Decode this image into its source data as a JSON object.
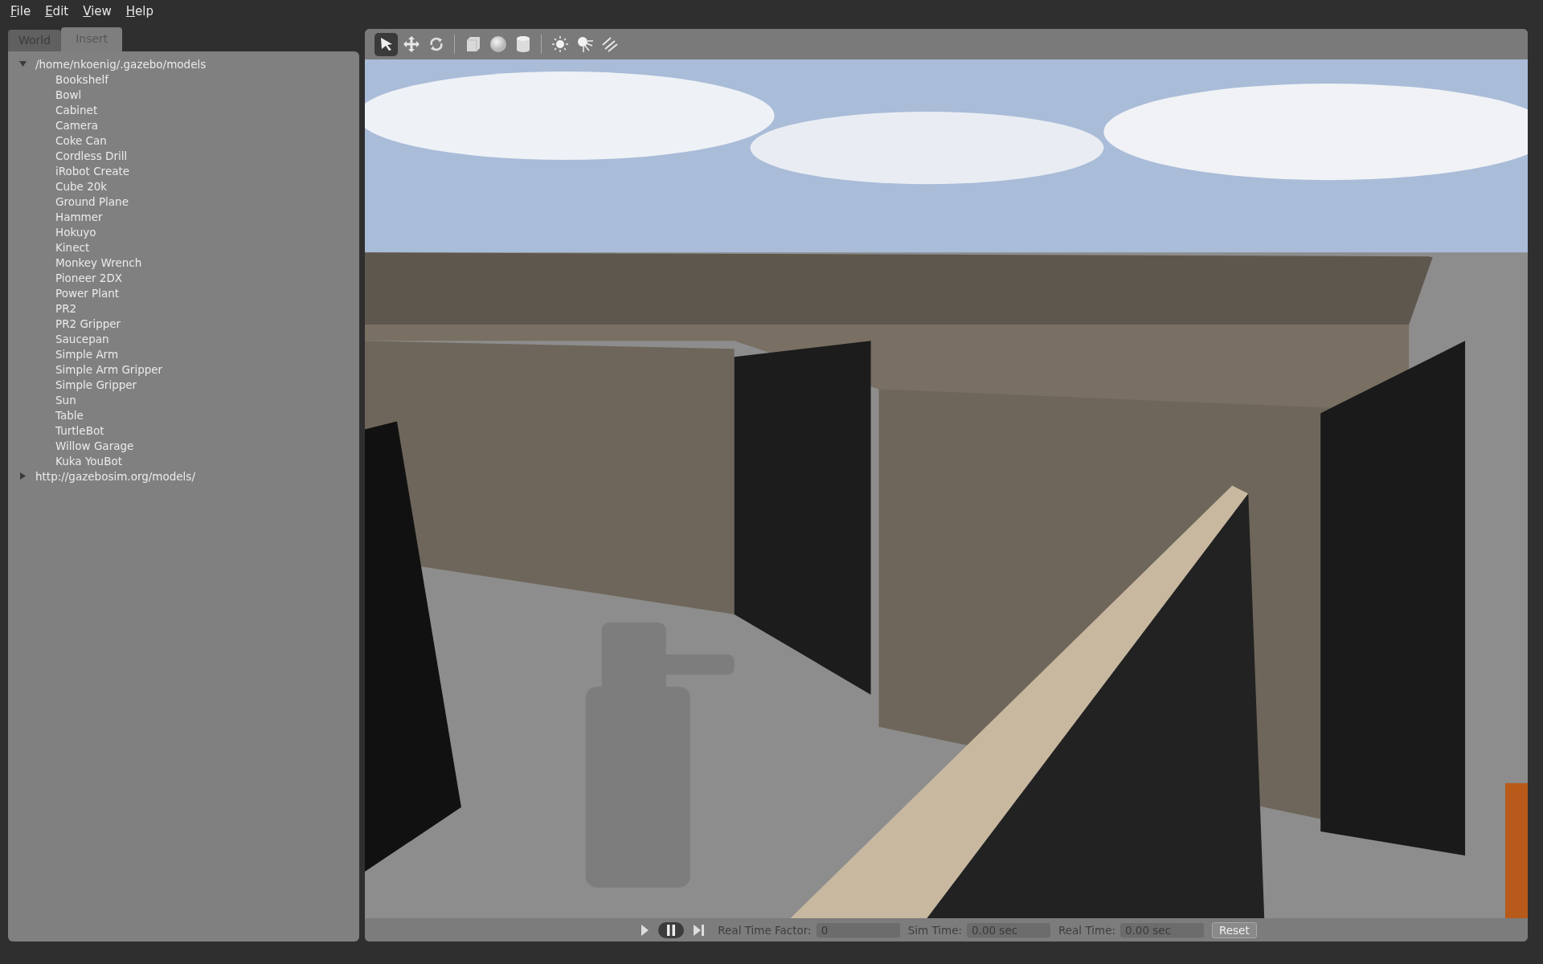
{
  "menu": [
    "File",
    "Edit",
    "View",
    "Help"
  ],
  "tabs": [
    {
      "label": "World",
      "selected": false
    },
    {
      "label": "Insert",
      "selected": true
    }
  ],
  "tree": [
    {
      "label": "/home/nkoenig/.gazebo/models",
      "expanded": true,
      "children": [
        {
          "label": "Bookshelf"
        },
        {
          "label": "Bowl"
        },
        {
          "label": "Cabinet"
        },
        {
          "label": "Camera"
        },
        {
          "label": "Coke Can"
        },
        {
          "label": "Cordless Drill"
        },
        {
          "label": "iRobot Create"
        },
        {
          "label": "Cube 20k"
        },
        {
          "label": "Ground Plane"
        },
        {
          "label": "Hammer"
        },
        {
          "label": "Hokuyo"
        },
        {
          "label": "Kinect"
        },
        {
          "label": "Monkey Wrench"
        },
        {
          "label": "Pioneer 2DX"
        },
        {
          "label": "Power Plant"
        },
        {
          "label": "PR2"
        },
        {
          "label": "PR2 Gripper"
        },
        {
          "label": "Saucepan"
        },
        {
          "label": "Simple Arm"
        },
        {
          "label": "Simple Arm Gripper"
        },
        {
          "label": "Simple Gripper"
        },
        {
          "label": "Sun"
        },
        {
          "label": "Table"
        },
        {
          "label": "TurtleBot"
        },
        {
          "label": "Willow Garage"
        },
        {
          "label": "Kuka YouBot"
        }
      ]
    },
    {
      "label": "http://gazebosim.org/models/",
      "expanded": false
    }
  ],
  "toolbar": [
    [
      {
        "kind": "arrow",
        "selected": true
      },
      {
        "kind": "move",
        "selected": false
      },
      {
        "kind": "rotate",
        "selected": false
      }
    ],
    [
      {
        "kind": "box",
        "selected": false
      },
      {
        "kind": "sphere",
        "selected": false
      },
      {
        "kind": "cylinder",
        "selected": false
      }
    ],
    [
      {
        "kind": "pointlight",
        "selected": false
      },
      {
        "kind": "spotlight",
        "selected": false
      },
      {
        "kind": "dirlight",
        "selected": false
      }
    ]
  ],
  "viewport": {
    "kind": "picture"
  },
  "playback": [
    {
      "kind": "play",
      "selected": false
    },
    {
      "kind": "pause",
      "selected": true
    },
    {
      "kind": "step",
      "selected": false
    }
  ],
  "status_fields": [
    {
      "label": "Real Time Factor:",
      "value": "0"
    },
    {
      "label": "Sim Time:",
      "value": "0.00 sec"
    },
    {
      "label": "Real Time:",
      "value": "0.00 sec"
    }
  ],
  "reset_button": "Reset"
}
